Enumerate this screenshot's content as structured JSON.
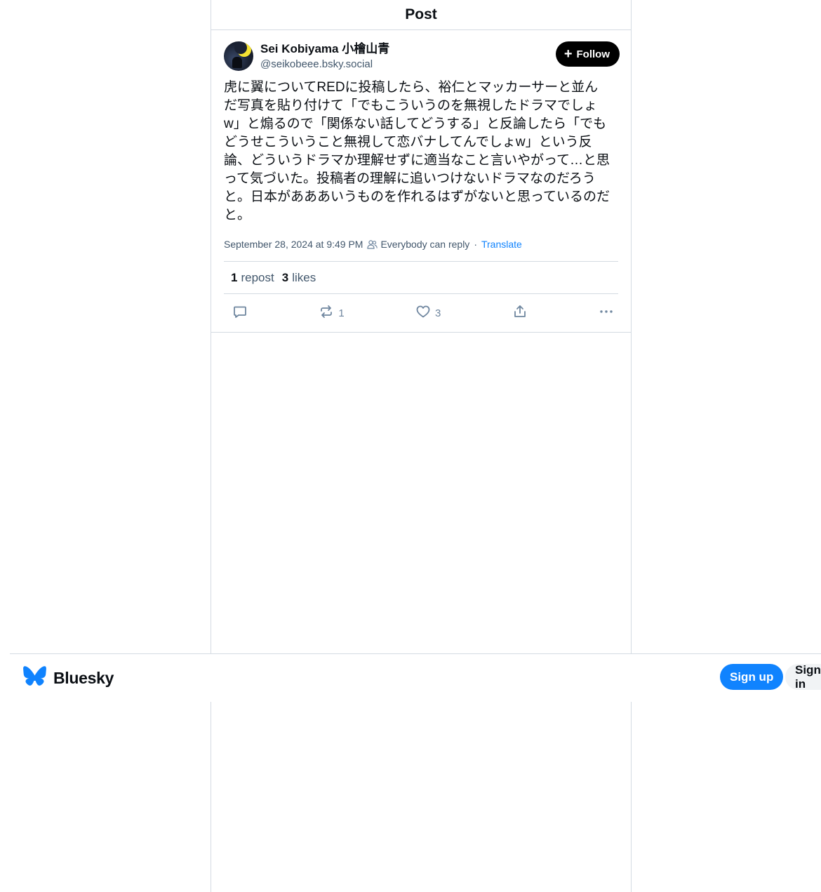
{
  "header": {
    "title": "Post"
  },
  "post": {
    "author": {
      "display_name": "Sei Kobiyama 小檜山青",
      "handle": "@seikobeee.bsky.social"
    },
    "follow_label": "Follow",
    "text": "虎に翼についてREDに投稿したら、裕仁とマッカーサーと並んだ写真を貼り付けて「でもこういうのを無視したドラマでしょw」と煽るので「関係ない話してどうする」と反論したら「でもどうせこういうこと無視して恋バナしてんでしょw」という反論、どういうドラマか理解せずに適当なこと言いやがって…と思って気づいた。投稿者の理解に追いつけないドラマなのだろうと。日本があああいうものを作れるはずがないと思っているのだと。",
    "timestamp": "September 28, 2024 at 9:49 PM",
    "reply_setting": "Everybody can reply",
    "separator": "·",
    "translate_label": "Translate",
    "stats": {
      "reposts_count": "1",
      "reposts_label": "repost",
      "likes_count": "3",
      "likes_label": "likes"
    },
    "actions": {
      "reply_icon": "reply-icon",
      "repost_icon": "repost-icon",
      "repost_count": "1",
      "like_icon": "heart-icon",
      "like_count": "3",
      "share_icon": "share-icon",
      "more_icon": "more-icon"
    }
  },
  "bottom_bar": {
    "brand_name": "Bluesky",
    "signup_label": "Sign up",
    "signin_label": "Sign in"
  },
  "colors": {
    "accent": "#1083fe",
    "border": "#d4dbe2",
    "muted_text": "#42576c",
    "icon_gray": "#6f869f"
  }
}
